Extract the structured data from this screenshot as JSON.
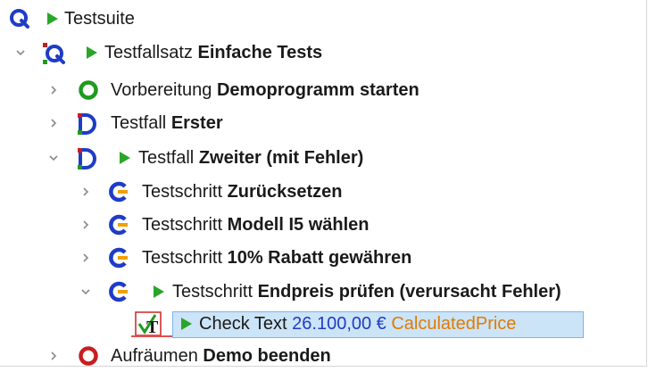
{
  "tree": {
    "root": {
      "icon": "qf-test-q-icon",
      "label": "Testsuite"
    },
    "testset": {
      "icon": "testset-icon",
      "type": "Testfallsatz",
      "name": "Einfache Tests"
    },
    "setup": {
      "icon": "setup-green-circle-icon",
      "type": "Vorbereitung",
      "name": "Demoprogramm starten"
    },
    "case1": {
      "icon": "testcase-d-icon",
      "type": "Testfall",
      "name": "Erster"
    },
    "case2": {
      "icon": "testcase-d-icon",
      "type": "Testfall",
      "name": "Zweiter (mit Fehler)"
    },
    "steps": [
      {
        "icon": "teststep-c-icon",
        "type": "Testschritt",
        "name": "Zurücksetzen"
      },
      {
        "icon": "teststep-c-icon",
        "type": "Testschritt",
        "name": "Modell I5 wählen"
      },
      {
        "icon": "teststep-c-icon",
        "type": "Testschritt",
        "name": "10% Rabatt gewähren"
      },
      {
        "icon": "teststep-c-icon",
        "type": "Testschritt",
        "name": "Endpreis prüfen (verursacht Fehler)"
      }
    ],
    "check": {
      "icon": "check-text-icon",
      "label": "Check Text",
      "value": "26.100,00 €",
      "component": "CalculatedPrice"
    },
    "cleanup": {
      "icon": "cleanup-red-circle-icon",
      "type": "Aufräumen",
      "name": "Demo beenden"
    }
  },
  "colors": {
    "play": "#2aa52a",
    "blue_icon": "#1f3cc7",
    "green_icon": "#1e9a1e",
    "red_icon": "#c81e1e",
    "selection": "#cce4f7",
    "value_text": "#1f3cc7",
    "component_text": "#e07b00"
  }
}
